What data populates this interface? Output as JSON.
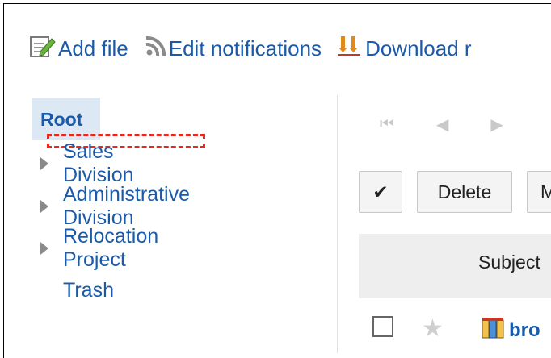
{
  "toolbar": {
    "add_file": "Add file",
    "edit_notifications": "Edit notifications",
    "download": "Download r"
  },
  "tree": {
    "root": "Root",
    "items": [
      {
        "label": "Sales Division"
      },
      {
        "label": "Administrative Division"
      },
      {
        "label": "Relocation Project"
      },
      {
        "label": "Trash"
      }
    ]
  },
  "pager": {
    "first": "⏮",
    "prev": "◀",
    "next": "▶"
  },
  "actions": {
    "check_all": "✔",
    "delete": "Delete",
    "move": "M"
  },
  "table": {
    "subject_header": "Subject",
    "rows": [
      {
        "name": "bro"
      }
    ]
  },
  "colors": {
    "link": "#1a5aa8",
    "root_highlight": "#dce9f5",
    "drop_marker": "#e8281e"
  }
}
